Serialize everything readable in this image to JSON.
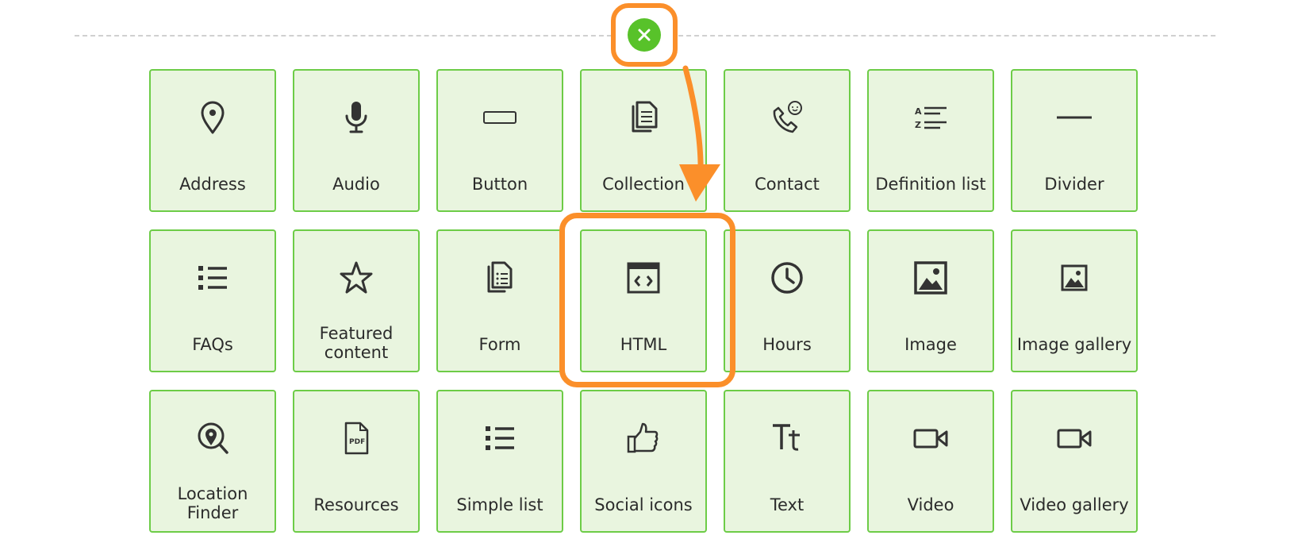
{
  "insert_button": {
    "icon": "close-icon"
  },
  "highlighted_item": "HTML",
  "annotation_color": "#fb8f2a",
  "tile_background": "#e9f5df",
  "tile_border": "#6dcc47",
  "components": [
    {
      "label": "Address",
      "icon": "map-pin-icon"
    },
    {
      "label": "Audio",
      "icon": "microphone-icon"
    },
    {
      "label": "Button",
      "icon": "button-rectangle-icon"
    },
    {
      "label": "Collection",
      "icon": "documents-icon"
    },
    {
      "label": "Contact",
      "icon": "phone-chat-icon"
    },
    {
      "label": "Definition list",
      "icon": "az-list-icon"
    },
    {
      "label": "Divider",
      "icon": "horizontal-line-icon"
    },
    {
      "label": "FAQs",
      "icon": "bullet-list-icon"
    },
    {
      "label": "Featured\ncontent",
      "icon": "star-icon"
    },
    {
      "label": "Form",
      "icon": "form-document-icon"
    },
    {
      "label": "HTML",
      "icon": "code-window-icon"
    },
    {
      "label": "Hours",
      "icon": "clock-icon"
    },
    {
      "label": "Image",
      "icon": "image-icon"
    },
    {
      "label": "Image gallery",
      "icon": "image-gallery-icon"
    },
    {
      "label": "Location\nFinder",
      "icon": "location-search-icon"
    },
    {
      "label": "Resources",
      "icon": "pdf-icon"
    },
    {
      "label": "Simple list",
      "icon": "simple-list-icon"
    },
    {
      "label": "Social icons",
      "icon": "thumbs-up-icon"
    },
    {
      "label": "Text",
      "icon": "text-tt-icon"
    },
    {
      "label": "Video",
      "icon": "video-camera-icon"
    },
    {
      "label": "Video gallery",
      "icon": "video-gallery-icon"
    }
  ]
}
